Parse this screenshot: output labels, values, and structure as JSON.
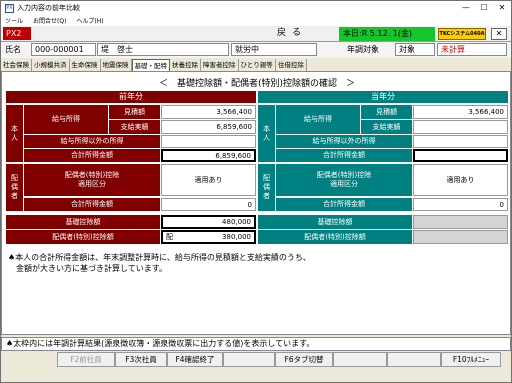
{
  "window": {
    "app_icon": "PX",
    "title": "入力内容の前年比較",
    "min": "—",
    "max": "☐",
    "close": "✕"
  },
  "menu": [
    "ツール",
    "お問合せ(Q)",
    "ヘルプ(H)"
  ],
  "topbar": {
    "tag": "PX2",
    "back": "戻る",
    "today": "本日:R 5.12. 1(金)",
    "brand": "TKCシステム040A",
    "close": "✕"
  },
  "info": {
    "name_label": "氏名",
    "code": "000-000001",
    "name": "堤　啓士",
    "status": "就労中",
    "year_label": "年調対象",
    "year_value": "対象",
    "calc_state": "未計算"
  },
  "tabs": [
    "社会保険",
    "小規模共済",
    "生命保険",
    "地震保険",
    "基礎・配特",
    "扶養控除",
    "障害者控除",
    "ひとり親等",
    "住借控除"
  ],
  "panel": {
    "title": "＜　基礎控除額・配偶者(特別)控除額の確認　＞",
    "prev_header": "前年分",
    "curr_header": "当年分",
    "honnin": "本\n人",
    "haigusha": "配\n偶\n者",
    "kyuyo": "給与所得",
    "mitsumori": "見積額",
    "shiharai": "支給実績",
    "other": "給与所得以外の所得",
    "total": "合計所得金額",
    "kubun": "配偶者(特別)控除\n適用区分",
    "tekiyo": "適用あり",
    "kiso": "基礎控除額",
    "haikoujo": "配偶者(特別)控除額",
    "prev": {
      "mitsumori": "3,566,400",
      "shiharai": "6,859,600",
      "other": "",
      "total": "6,859,600",
      "sp_total": "0",
      "kiso": "480,000",
      "hai_tag": "配",
      "hai": "380,000"
    },
    "curr": {
      "mitsumori": "3,566,400",
      "shiharai": "",
      "other": "",
      "total": "",
      "sp_total": "0",
      "kiso": "",
      "hai": ""
    },
    "note": "♠本人の合計所得金額は、年末調整計算時に、給与所得の見積額と支給実績のうち、\n　金額が大きい方に基づき計算しています。"
  },
  "status": "♠太枠内には年調計算結果(源泉徴収簿・源泉徴収票に出力する値)を表示しています。",
  "fkeys": {
    "f2": "F2前社員",
    "f3": "F3次社員",
    "f4": "F4確認終了",
    "f6": "F6タブ切替",
    "f10": "F10ﾌﾙﾒﾆｭｰ"
  }
}
